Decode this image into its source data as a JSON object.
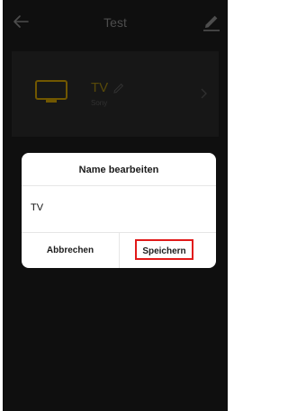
{
  "header": {
    "title": "Test"
  },
  "device": {
    "name": "TV",
    "brand": "Sony"
  },
  "dialog": {
    "title": "Name bearbeiten",
    "input_value": "TV",
    "cancel_label": "Abbrechen",
    "save_label": "Speichern"
  },
  "colors": {
    "background": "#131313",
    "card": "#1d1d1d",
    "accent": "#c99a00",
    "highlight": "#e11a1a"
  },
  "icons": [
    "back-arrow-icon",
    "edit-pencil-icon",
    "tv-icon",
    "pencil-icon",
    "chevron-right-icon"
  ]
}
